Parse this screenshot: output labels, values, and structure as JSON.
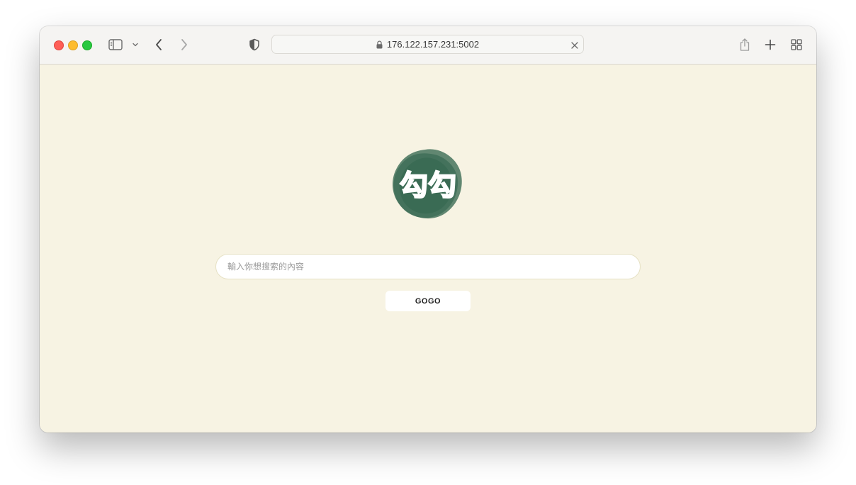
{
  "browser": {
    "url": "176.122.157.231:5002",
    "traffic_lights": {
      "close_color": "#fe5f57",
      "minimize_color": "#febc2e",
      "maximize_color": "#28c840"
    },
    "icons": {
      "sidebar": "sidebar-icon",
      "chevron": "chevron-down-icon",
      "back": "back-arrow-icon",
      "forward": "forward-arrow-icon",
      "privacy": "shield-icon",
      "lock": "lock-icon",
      "clear": "close-icon",
      "share": "share-icon",
      "new_tab": "plus-icon",
      "tab_overview": "grid-icon"
    }
  },
  "page": {
    "background_color": "#f7f3e3",
    "logo": {
      "text": "勾勾",
      "color": "#3f6f58"
    },
    "search": {
      "placeholder": "輸入你想搜索的內容",
      "value": ""
    },
    "submit_label": "GOGO"
  }
}
